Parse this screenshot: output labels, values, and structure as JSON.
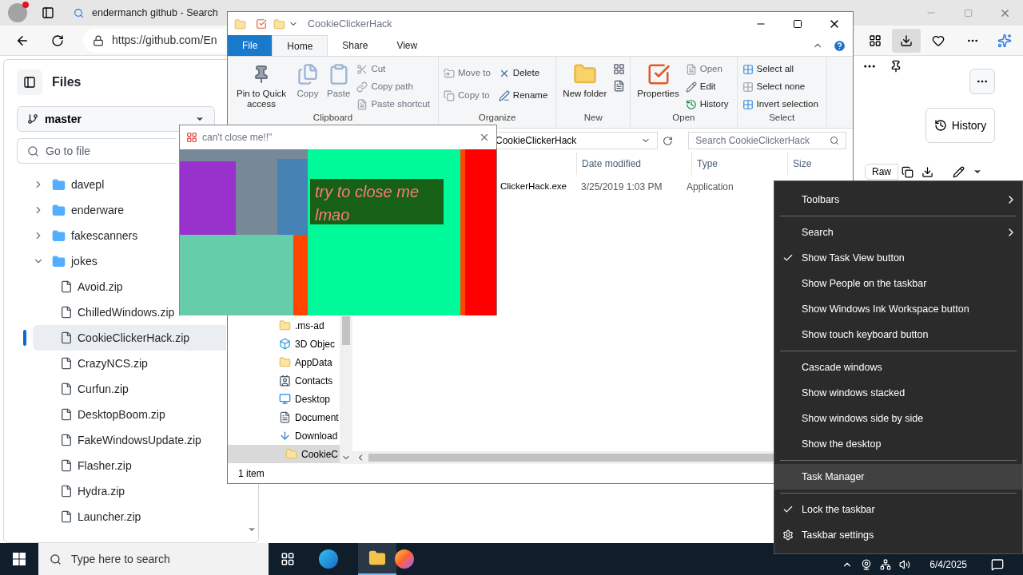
{
  "browser": {
    "tabs": [
      {
        "label": "endermanch github - Search",
        "selected": false
      }
    ],
    "address": "https://github.com/En"
  },
  "files_panel": {
    "title": "Files",
    "branch": "master",
    "search_placeholder": "Go to file",
    "tree": [
      {
        "name": "davepl",
        "kind": "folder",
        "expanded": false
      },
      {
        "name": "enderware",
        "kind": "folder",
        "expanded": false
      },
      {
        "name": "fakescanners",
        "kind": "folder",
        "expanded": false
      },
      {
        "name": "jokes",
        "kind": "folder",
        "expanded": true,
        "children": [
          {
            "name": "Avoid.zip",
            "kind": "file",
            "selected": false
          },
          {
            "name": "ChilledWindows.zip",
            "kind": "file",
            "selected": false
          },
          {
            "name": "CookieClickerHack.zip",
            "kind": "file",
            "selected": true
          },
          {
            "name": "CrazyNCS.zip",
            "kind": "file",
            "selected": false
          },
          {
            "name": "Curfun.zip",
            "kind": "file",
            "selected": false
          },
          {
            "name": "DesktopBoom.zip",
            "kind": "file",
            "selected": false
          },
          {
            "name": "FakeWindowsUpdate.zip",
            "kind": "file",
            "selected": false
          },
          {
            "name": "Flasher.zip",
            "kind": "file",
            "selected": false
          },
          {
            "name": "Hydra.zip",
            "kind": "file",
            "selected": false
          },
          {
            "name": "Launcher.zip",
            "kind": "file",
            "selected": false
          }
        ]
      }
    ]
  },
  "file_toolbar": {
    "history": "History",
    "raw": "Raw"
  },
  "explorer": {
    "title": "CookieClickerHack",
    "ribbon_tabs": [
      {
        "label": "File",
        "kind": "file",
        "selected": false
      },
      {
        "label": "Home",
        "kind": "tab",
        "selected": true
      },
      {
        "label": "Share",
        "kind": "tab",
        "selected": false
      },
      {
        "label": "View",
        "kind": "tab",
        "selected": false
      }
    ],
    "groups": [
      {
        "label": "Clipboard",
        "items": [
          {
            "label": "Pin to Quick access",
            "kind": "large",
            "disabled": false
          },
          {
            "label": "Copy",
            "kind": "large",
            "disabled": true
          },
          {
            "label": "Paste",
            "kind": "large",
            "disabled": true
          },
          {
            "label": "Cut",
            "kind": "small",
            "disabled": true
          },
          {
            "label": "Copy path",
            "kind": "small",
            "disabled": true
          },
          {
            "label": "Paste shortcut",
            "kind": "small",
            "disabled": true
          }
        ]
      },
      {
        "label": "Organize",
        "items": [
          {
            "label": "Move to",
            "kind": "small",
            "disabled": true
          },
          {
            "label": "Copy to",
            "kind": "small",
            "disabled": true
          },
          {
            "label": "Delete",
            "kind": "small",
            "disabled": false
          },
          {
            "label": "Rename",
            "kind": "small",
            "disabled": false
          }
        ]
      },
      {
        "label": "New",
        "items": [
          {
            "label": "New folder",
            "kind": "large",
            "disabled": false
          }
        ]
      },
      {
        "label": "Open",
        "items": [
          {
            "label": "Properties",
            "kind": "large",
            "disabled": false
          },
          {
            "label": "Open",
            "kind": "small",
            "disabled": true
          },
          {
            "label": "Edit",
            "kind": "small",
            "disabled": false
          },
          {
            "label": "History",
            "kind": "small",
            "disabled": false
          }
        ]
      },
      {
        "label": "Select",
        "items": [
          {
            "label": "Select all",
            "kind": "small",
            "disabled": false
          },
          {
            "label": "Select none",
            "kind": "small",
            "disabled": false
          },
          {
            "label": "Invert selection",
            "kind": "small",
            "disabled": false
          }
        ]
      }
    ],
    "address": "CookieClickerHack",
    "search_placeholder": "Search CookieClickerHack",
    "columns": [
      "Date modified",
      "Type",
      "Size"
    ],
    "rows": [
      {
        "name": "ClickerHack.exe",
        "date": "3/25/2019 1:03 PM",
        "type": "Application"
      }
    ],
    "nav": [
      {
        "label": ".ms-ad",
        "kind": "folder",
        "selected": false
      },
      {
        "label": "3D Objec",
        "kind": "cube",
        "selected": false
      },
      {
        "label": "AppData",
        "kind": "folder",
        "selected": false
      },
      {
        "label": "Contacts",
        "kind": "contacts",
        "selected": false
      },
      {
        "label": "Desktop",
        "kind": "desktop",
        "selected": false
      },
      {
        "label": "Document",
        "kind": "document",
        "selected": false
      },
      {
        "label": "Download",
        "kind": "download",
        "selected": false
      },
      {
        "label": "CookieC",
        "kind": "folder",
        "selected": true
      }
    ],
    "status": "1 item"
  },
  "popup": {
    "title": "can't close me!!\"",
    "message": "try to close me lmao"
  },
  "context_menu": [
    {
      "kind": "submenu",
      "label": "Toolbars",
      "checked": false,
      "selected": false
    },
    {
      "kind": "separator"
    },
    {
      "kind": "submenu",
      "label": "Search",
      "checked": false,
      "selected": false
    },
    {
      "kind": "item",
      "label": "Show Task View button",
      "checked": true,
      "selected": false
    },
    {
      "kind": "item",
      "label": "Show People on the taskbar",
      "checked": false,
      "selected": false
    },
    {
      "kind": "item",
      "label": "Show Windows Ink Workspace button",
      "checked": false,
      "selected": false
    },
    {
      "kind": "item",
      "label": "Show touch keyboard button",
      "checked": false,
      "selected": false
    },
    {
      "kind": "separator"
    },
    {
      "kind": "item",
      "label": "Cascade windows",
      "checked": false,
      "selected": false
    },
    {
      "kind": "item",
      "label": "Show windows stacked",
      "checked": false,
      "selected": false
    },
    {
      "kind": "item",
      "label": "Show windows side by side",
      "checked": false,
      "selected": false
    },
    {
      "kind": "item",
      "label": "Show the desktop",
      "checked": false,
      "selected": false
    },
    {
      "kind": "separator"
    },
    {
      "kind": "item",
      "label": "Task Manager",
      "checked": false,
      "selected": true
    },
    {
      "kind": "separator"
    },
    {
      "kind": "item",
      "label": "Lock the taskbar",
      "checked": true,
      "selected": false
    },
    {
      "kind": "settings",
      "label": "Taskbar settings",
      "checked": false,
      "selected": false
    }
  ],
  "taskbar": {
    "search_placeholder": "Type here to search",
    "date": "6/4/2025"
  }
}
